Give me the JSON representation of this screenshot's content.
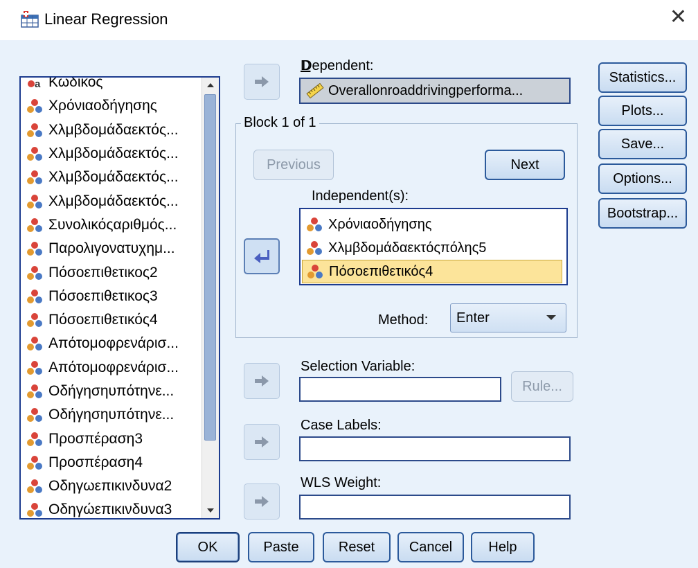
{
  "window": {
    "title": "Linear Regression"
  },
  "variables": [
    "Κωδικός",
    "Χρόνιαοδήγησης",
    "Χλμβδομάδαεκτός...",
    "Χλμβδομάδαεκτός...",
    "Χλμβδομάδαεκτός...",
    "Χλμβδομάδαεκτός...",
    "Συνολικόςαριθμός...",
    "Παρολιγονατυχημ...",
    "Πόσοεπιθετικος2",
    "Πόσοεπιθετικος3",
    "Πόσοεπιθετικός4",
    "Απότομοφρενάρισ...",
    "Απότομοφρενάρισ...",
    "Οδήγησηυπότηνε...",
    "Οδήγησηυπότηνε...",
    "Προσπέραση3",
    "Προσπέραση4",
    "Οδηγωεπικινδυνα2",
    "Οδηγώεπικινδυνα3"
  ],
  "dependent": {
    "label": "Dependent:",
    "value": "Overallonroaddrivingperforma..."
  },
  "block": {
    "title": "Block 1 of 1",
    "previous_label": "Previous",
    "next_label": "Next",
    "independents_label": "Independent(s):",
    "independents": [
      "Χρόνιαοδήγησης",
      "Χλμβδομάδαεκτόςπόλης5",
      "Πόσοεπιθετικός4"
    ],
    "method_label": "Method:",
    "method_value": "Enter"
  },
  "selection": {
    "label": "Selection Variable:",
    "rule_label": "Rule..."
  },
  "case_labels": {
    "label": "Case Labels:"
  },
  "wls": {
    "label": "WLS Weight:"
  },
  "side_buttons": [
    "Statistics...",
    "Plots...",
    "Save...",
    "Options...",
    "Bootstrap..."
  ],
  "bottom_buttons": [
    "OK",
    "Paste",
    "Reset",
    "Cancel",
    "Help"
  ],
  "icons": {
    "app": "spss-table-icon",
    "nominal": "nominal-variable-icon",
    "scale": "scale-ruler-icon",
    "string": "string-variable-icon",
    "arrow": "move-arrow-icon"
  }
}
